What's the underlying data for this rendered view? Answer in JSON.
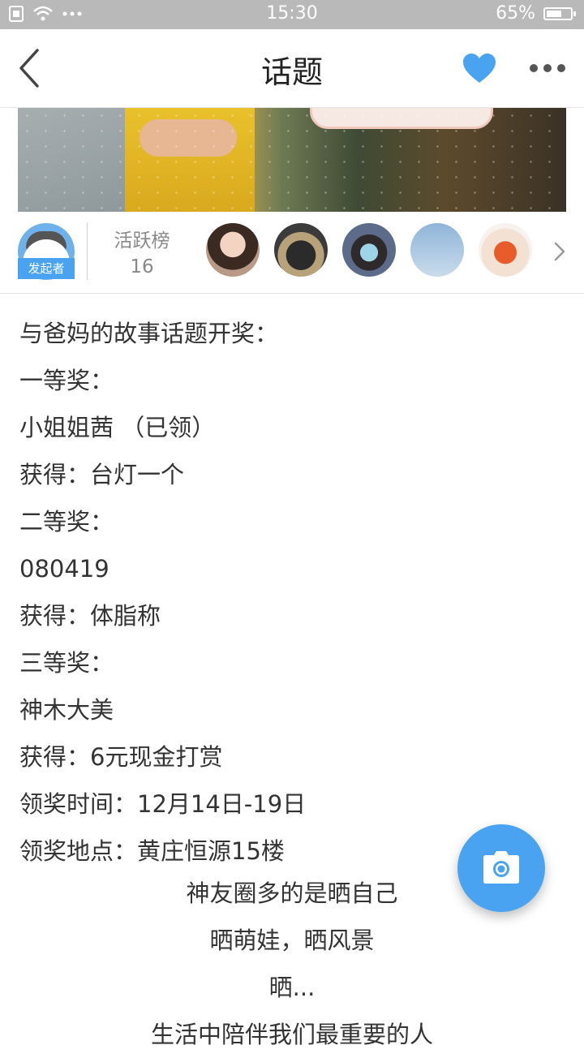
{
  "status_bar": {
    "time": "15:30",
    "battery": "65%",
    "battery_level": 0.65,
    "icons": [
      "sim-icon",
      "wifi-icon",
      "more-dots-icon"
    ]
  },
  "nav": {
    "title": "话题",
    "back_icon": "chevron-left-icon",
    "favorite_icon": "heart-icon",
    "more_icon": "ellipsis-icon",
    "accent_color": "#4aa3f0"
  },
  "participants": {
    "initiator_label": "发起者",
    "rank_label": "活跃榜",
    "rank_count": "16"
  },
  "content": {
    "lines": [
      "与爸妈的故事话题开奖：",
      "一等奖：",
      "小姐姐茜 （已领）",
      "获得：台灯一个",
      "二等奖：",
      "080419",
      "获得：体脂称",
      "三等奖：",
      "神木大美",
      "获得：6元现金打赏",
      "领奖时间：12月14日-19日",
      "领奖地点：黄庄恒源15楼"
    ],
    "centered_lines": [
      "神友圈多的是晒自己",
      "晒萌娃，晒风景",
      "晒...",
      "生活中陪伴我们最重要的人"
    ]
  },
  "fab": {
    "icon": "camera-icon"
  }
}
